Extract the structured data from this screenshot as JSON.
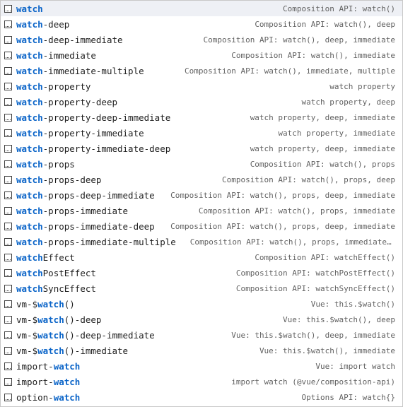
{
  "suggestions": [
    {
      "pre": "",
      "match": "watch",
      "post": "",
      "detail": "Composition API: watch()",
      "selected": true
    },
    {
      "pre": "",
      "match": "watch",
      "post": "-deep",
      "detail": "Composition API: watch(), deep"
    },
    {
      "pre": "",
      "match": "watch",
      "post": "-deep-immediate",
      "detail": "Composition API: watch(), deep, immediate"
    },
    {
      "pre": "",
      "match": "watch",
      "post": "-immediate",
      "detail": "Composition API: watch(), immediate"
    },
    {
      "pre": "",
      "match": "watch",
      "post": "-immediate-multiple",
      "detail": "Composition API: watch(), immediate, multiple"
    },
    {
      "pre": "",
      "match": "watch",
      "post": "-property",
      "detail": "watch property"
    },
    {
      "pre": "",
      "match": "watch",
      "post": "-property-deep",
      "detail": "watch property, deep"
    },
    {
      "pre": "",
      "match": "watch",
      "post": "-property-deep-immediate",
      "detail": "watch property, deep, immediate"
    },
    {
      "pre": "",
      "match": "watch",
      "post": "-property-immediate",
      "detail": "watch property, immediate"
    },
    {
      "pre": "",
      "match": "watch",
      "post": "-property-immediate-deep",
      "detail": "watch property, deep, immediate"
    },
    {
      "pre": "",
      "match": "watch",
      "post": "-props",
      "detail": "Composition API: watch(), props"
    },
    {
      "pre": "",
      "match": "watch",
      "post": "-props-deep",
      "detail": "Composition API: watch(), props, deep"
    },
    {
      "pre": "",
      "match": "watch",
      "post": "-props-deep-immediate",
      "detail": "Composition API: watch(), props, deep, immediate"
    },
    {
      "pre": "",
      "match": "watch",
      "post": "-props-immediate",
      "detail": "Composition API: watch(), props, immediate"
    },
    {
      "pre": "",
      "match": "watch",
      "post": "-props-immediate-deep",
      "detail": "Composition API: watch(), props, deep, immediate"
    },
    {
      "pre": "",
      "match": "watch",
      "post": "-props-immediate-multiple",
      "detail": "Composition API: watch(), props, immediate, multi…"
    },
    {
      "pre": "",
      "match": "watch",
      "post": "Effect",
      "detail": "Composition API: watchEffect()"
    },
    {
      "pre": "",
      "match": "watch",
      "post": "PostEffect",
      "detail": "Composition API: watchPostEffect()"
    },
    {
      "pre": "",
      "match": "watch",
      "post": "SyncEffect",
      "detail": "Composition API: watchSyncEffect()"
    },
    {
      "pre": "vm-$",
      "match": "watch",
      "post": "()",
      "detail": "Vue: this.$watch()"
    },
    {
      "pre": "vm-$",
      "match": "watch",
      "post": "()-deep",
      "detail": "Vue: this.$watch(), deep"
    },
    {
      "pre": "vm-$",
      "match": "watch",
      "post": "()-deep-immediate",
      "detail": "Vue: this.$watch(), deep, immediate"
    },
    {
      "pre": "vm-$",
      "match": "watch",
      "post": "()-immediate",
      "detail": "Vue: this.$watch(), immediate"
    },
    {
      "pre": "import-",
      "match": "watch",
      "post": "",
      "detail": "Vue: import watch"
    },
    {
      "pre": "import-",
      "match": "watch",
      "post": "",
      "detail": "import watch (@vue/composition-api)"
    },
    {
      "pre": "option-",
      "match": "watch",
      "post": "",
      "detail": "Options API: watch{}"
    }
  ],
  "icon": "snippet-icon",
  "colors": {
    "highlight": "#0a64c8",
    "selected_bg": "#eef0f5",
    "detail_text": "#616161",
    "label_text": "#1e1e1e"
  }
}
